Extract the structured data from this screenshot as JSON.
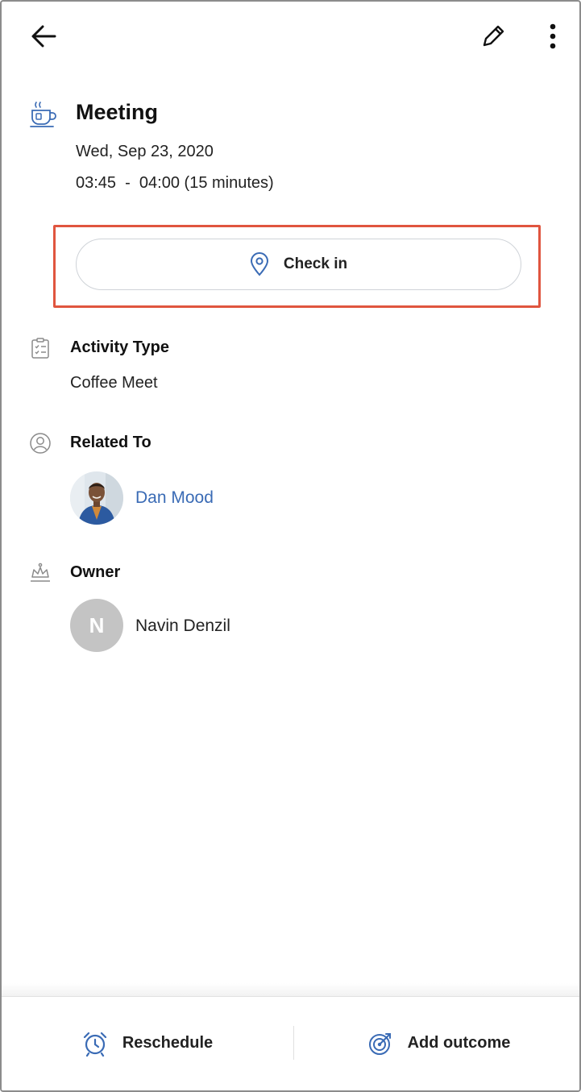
{
  "header": {
    "back_icon": "arrow-left-icon",
    "edit_icon": "pencil-icon",
    "more_icon": "more-vertical-icon"
  },
  "meeting": {
    "icon": "coffee-cup-icon",
    "title": "Meeting",
    "date": "Wed, Sep 23, 2020",
    "time": "03:45  -  04:00 (15 minutes)"
  },
  "check_in": {
    "icon": "location-pin-icon",
    "label": "Check in"
  },
  "activity_type": {
    "icon": "clipboard-checklist-icon",
    "label": "Activity Type",
    "value": "Coffee Meet"
  },
  "related_to": {
    "icon": "user-circle-icon",
    "label": "Related To",
    "name": "Dan Mood"
  },
  "owner": {
    "icon": "crown-icon",
    "label": "Owner",
    "initial": "N",
    "name": "Navin Denzil"
  },
  "bottom_bar": {
    "reschedule_icon": "alarm-clock-icon",
    "reschedule_label": "Reschedule",
    "outcome_icon": "target-icon",
    "outcome_label": "Add outcome"
  },
  "colors": {
    "accent_blue": "#3a6bb5",
    "highlight_red": "#e0553f",
    "icon_gray": "#8a8a8a",
    "avatar_gray": "#c4c4c4"
  }
}
